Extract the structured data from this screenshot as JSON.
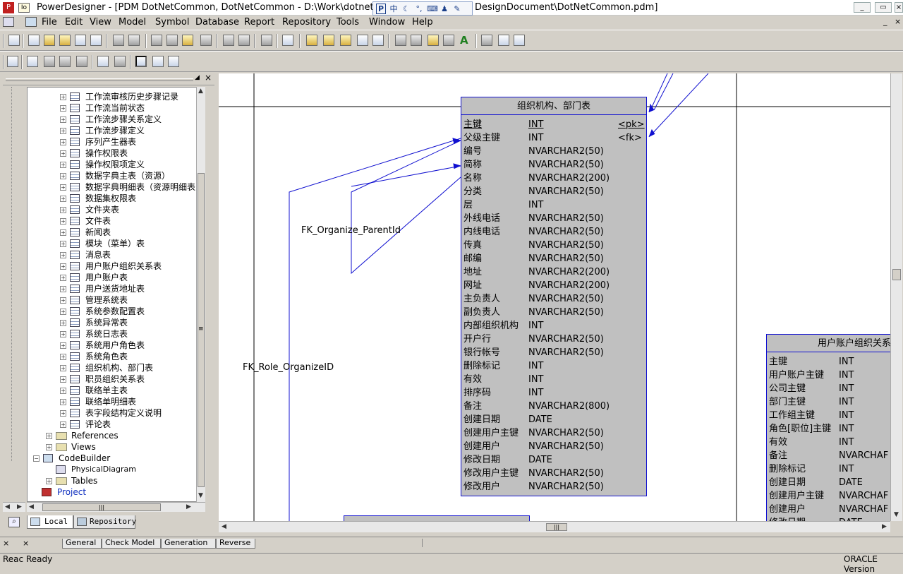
{
  "window": {
    "title": "PowerDesigner - [PDM DotNetCommon, DotNetCommon - D:\\Work\\dotnet\\Dot",
    "title_tail": "DesignDocument\\DotNetCommon.pdm]"
  },
  "menu": [
    "File",
    "Edit",
    "View",
    "Model",
    "Symbol",
    "Database",
    "Report",
    "Repository",
    "Tools",
    "Window",
    "Help"
  ],
  "tree": {
    "tables": [
      "工作流审核历史步骤记录",
      "工作流当前状态",
      "工作流步骤关系定义",
      "工作流步骤定义",
      "序列产生器表",
      "操作权限表",
      "操作权限项定义",
      "数据字典主表（资源）",
      "数据字典明细表（资源明细表",
      "数据集权限表",
      "文件夹表",
      "文件表",
      "新闻表",
      "模块（菜单）表",
      "消息表",
      "用户账户组织关系表",
      "用户账户表",
      "用户送货地址表",
      "管理系统表",
      "系统参数配置表",
      "系统异常表",
      "系统日志表",
      "系统用户角色表",
      "系统角色表",
      "组织机构、部门表",
      "职员组织关系表",
      "联络单主表",
      "联络单明细表",
      "表字段结构定义说明",
      "评论表"
    ],
    "references": "References",
    "views": "Views",
    "codebuilder": "CodeBuilder",
    "physical_diagram": "PhysicalDiagram",
    "cb_tables": "Tables",
    "project": "Project"
  },
  "browser_tabs": {
    "local": "Local",
    "repository": "Repository"
  },
  "diagram": {
    "main_entity": {
      "title": "组织机构、部门表",
      "columns": [
        {
          "name": "主键",
          "type": "INT",
          "key": "<pk>"
        },
        {
          "name": "父级主键",
          "type": "INT",
          "key": "<fk>"
        },
        {
          "name": "编号",
          "type": "NVARCHAR2(50)",
          "key": ""
        },
        {
          "name": "简称",
          "type": "NVARCHAR2(50)",
          "key": ""
        },
        {
          "name": "名称",
          "type": "NVARCHAR2(200)",
          "key": ""
        },
        {
          "name": "分类",
          "type": "NVARCHAR2(50)",
          "key": ""
        },
        {
          "name": "层",
          "type": "INT",
          "key": ""
        },
        {
          "name": "外线电话",
          "type": "NVARCHAR2(50)",
          "key": ""
        },
        {
          "name": "内线电话",
          "type": "NVARCHAR2(50)",
          "key": ""
        },
        {
          "name": "传真",
          "type": "NVARCHAR2(50)",
          "key": ""
        },
        {
          "name": "邮编",
          "type": "NVARCHAR2(50)",
          "key": ""
        },
        {
          "name": "地址",
          "type": "NVARCHAR2(200)",
          "key": ""
        },
        {
          "name": "网址",
          "type": "NVARCHAR2(200)",
          "key": ""
        },
        {
          "name": "主负责人",
          "type": "NVARCHAR2(50)",
          "key": ""
        },
        {
          "name": "副负责人",
          "type": "NVARCHAR2(50)",
          "key": ""
        },
        {
          "name": "内部组织机构",
          "type": "INT",
          "key": ""
        },
        {
          "name": "开户行",
          "type": "NVARCHAR2(50)",
          "key": ""
        },
        {
          "name": "银行帐号",
          "type": "NVARCHAR2(50)",
          "key": ""
        },
        {
          "name": "删除标记",
          "type": "INT",
          "key": ""
        },
        {
          "name": "有效",
          "type": "INT",
          "key": ""
        },
        {
          "name": "排序码",
          "type": "INT",
          "key": ""
        },
        {
          "name": "备注",
          "type": "NVARCHAR2(800)",
          "key": ""
        },
        {
          "name": "创建日期",
          "type": "DATE",
          "key": ""
        },
        {
          "name": "创建用户主键",
          "type": "NVARCHAR2(50)",
          "key": ""
        },
        {
          "name": "创建用户",
          "type": "NVARCHAR2(50)",
          "key": ""
        },
        {
          "name": "修改日期",
          "type": "DATE",
          "key": ""
        },
        {
          "name": "修改用户主键",
          "type": "NVARCHAR2(50)",
          "key": ""
        },
        {
          "name": "修改用户",
          "type": "NVARCHAR2(50)",
          "key": ""
        }
      ]
    },
    "side_entity": {
      "title": "用户账户组织关系",
      "columns": [
        {
          "name": "主键",
          "type": "INT"
        },
        {
          "name": "用户账户主键",
          "type": "INT"
        },
        {
          "name": "公司主键",
          "type": "INT"
        },
        {
          "name": "部门主键",
          "type": "INT"
        },
        {
          "name": "工作组主键",
          "type": "INT"
        },
        {
          "name": "角色[职位]主键",
          "type": "INT"
        },
        {
          "name": "有效",
          "type": "INT"
        },
        {
          "name": "备注",
          "type": "NVARCHAF"
        },
        {
          "name": "删除标记",
          "type": "INT"
        },
        {
          "name": "创建日期",
          "type": "DATE"
        },
        {
          "name": "创建用户主键",
          "type": "NVARCHAF"
        },
        {
          "name": "创建用户",
          "type": "NVARCHAF"
        },
        {
          "name": "修改日期",
          "type": "DATE"
        }
      ]
    },
    "labels": {
      "fk_parent": "FK_Organize_ParentId",
      "fk_role": "FK_Role_OrganizeID"
    }
  },
  "output_tabs": [
    "General",
    "Check Model",
    "Generation",
    "Reverse"
  ],
  "status": {
    "left": "Reac Ready",
    "right": "ORACLE Version"
  }
}
